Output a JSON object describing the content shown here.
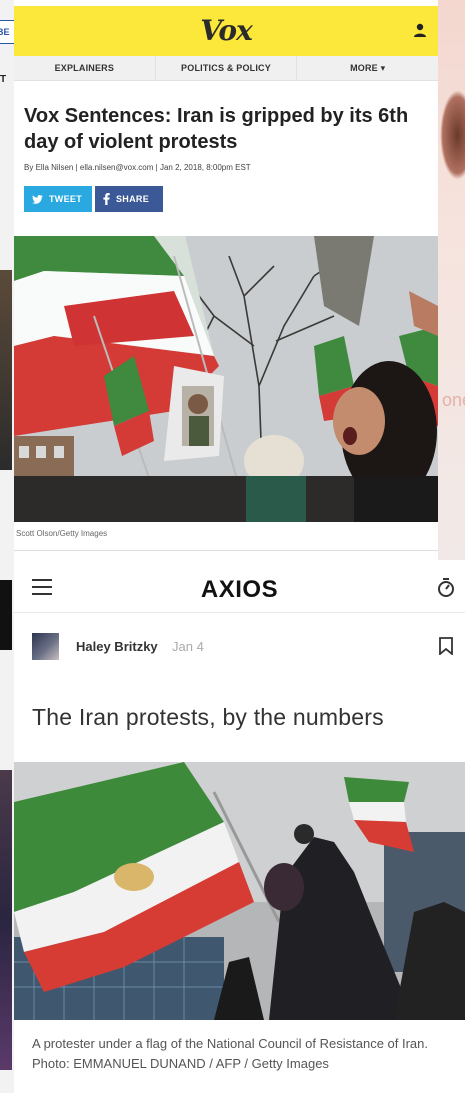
{
  "background": {
    "left_tab_text": "BE",
    "left_letter": "T",
    "right_text": "one"
  },
  "vox": {
    "logo": "Vox",
    "nav": [
      "EXPLAINERS",
      "POLITICS & POLICY",
      "MORE ▾"
    ],
    "title": "Vox Sentences: Iran is gripped by its 6th day of violent protests",
    "byline_prefix": "By",
    "author": "Ella Nilsen",
    "email": "ella.nilsen@vox.com",
    "date": "Jan 2, 2018, 8:00pm EST",
    "tweet_label": "TWEET",
    "share_label": "SHARE",
    "photo_credit": "Scott Olson/Getty Images",
    "colors": {
      "bar": "#fbe83b",
      "tweet": "#2aa9e0",
      "facebook": "#3b5997"
    }
  },
  "axios": {
    "logo": "AXIOS",
    "author": "Haley Britzky",
    "date": "Jan 4",
    "title": "The Iran protests, by the numbers",
    "caption": "A protester under a flag of the National Council of Resistance of Iran. Photo: EMMANUEL DUNAND / AFP / Getty Images"
  }
}
